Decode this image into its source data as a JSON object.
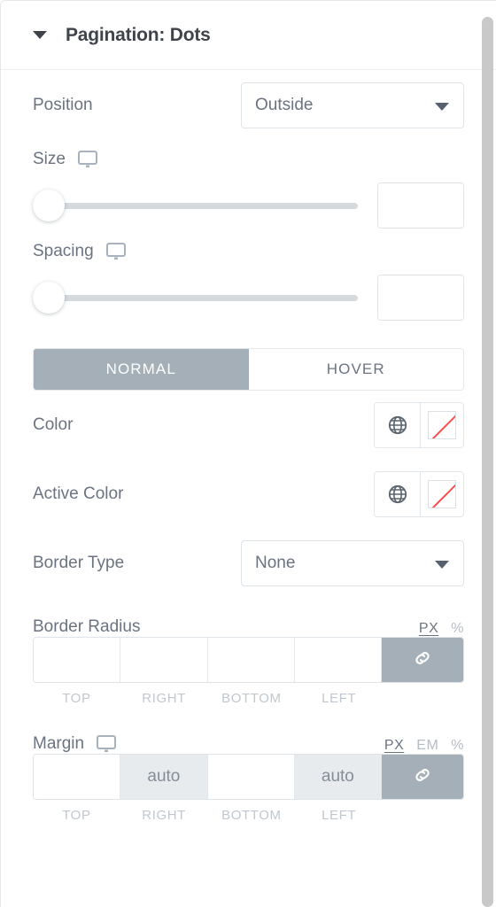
{
  "panel": {
    "section_title": "Pagination: Dots",
    "collapse_icon": "caret-down-icon"
  },
  "controls": {
    "position": {
      "label": "Position",
      "value": "Outside",
      "dropdown_icon": "chevron-down-icon"
    },
    "size": {
      "label": "Size",
      "responsive_icon": "desktop-monitor-icon",
      "slider_value": "",
      "input_value": "",
      "input_placeholder": ""
    },
    "spacing": {
      "label": "Spacing",
      "responsive_icon": "desktop-monitor-icon",
      "slider_value": "",
      "input_value": "",
      "input_placeholder": ""
    },
    "state_tabs": {
      "normal": "NORMAL",
      "hover": "HOVER",
      "active": "NORMAL"
    },
    "color": {
      "label": "Color",
      "globe_icon": "globe-icon",
      "swatch_icon": "no-color-swatch-icon",
      "value": ""
    },
    "active_color": {
      "label": "Active Color",
      "globe_icon": "globe-icon",
      "swatch_icon": "no-color-swatch-icon",
      "value": ""
    },
    "border_type": {
      "label": "Border Type",
      "value": "None",
      "dropdown_icon": "chevron-down-icon"
    },
    "border_radius": {
      "label": "Border Radius",
      "units": [
        {
          "text": "PX",
          "active": true
        },
        {
          "text": "%",
          "active": false
        }
      ],
      "values": [
        "",
        "",
        "",
        ""
      ],
      "sides": [
        "TOP",
        "RIGHT",
        "BOTTOM",
        "LEFT"
      ],
      "link_icon": "link-chain-icon",
      "linked": true
    },
    "margin": {
      "label": "Margin",
      "responsive_icon": "desktop-monitor-icon",
      "units": [
        {
          "text": "PX",
          "active": true
        },
        {
          "text": "EM",
          "active": false
        },
        {
          "text": "%",
          "active": false
        }
      ],
      "values": [
        "",
        "auto",
        "",
        "auto"
      ],
      "sides": [
        "TOP",
        "RIGHT",
        "BOTTOM",
        "LEFT"
      ],
      "link_icon": "link-chain-icon",
      "linked": true
    }
  },
  "colors": {
    "text_primary": "#3f444b",
    "text_label": "#6b7381",
    "accent_gray": "#a4afb7",
    "border": "#dfe4e8",
    "slider_track": "#d5dadf",
    "swatch_slash": "#fc4d4d",
    "scrollbar": "#c9c9c9"
  }
}
